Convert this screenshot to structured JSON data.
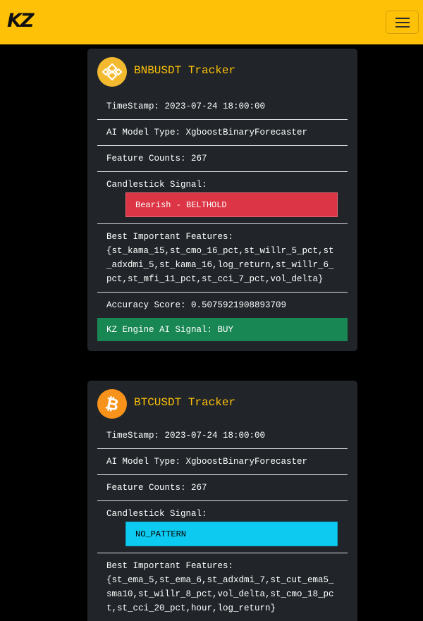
{
  "navbar": {
    "brand": "KZ",
    "menu_icon": "hamburger-menu-icon"
  },
  "colors": {
    "accent": "#ffc107",
    "card_bg": "#212529",
    "bearish": "#dc3545",
    "no_pattern": "#0dcaf0",
    "buy": "#198754"
  },
  "cards": [
    {
      "title": "BNBUSDT Tracker",
      "icon": "binance-coin-icon",
      "timestamp": "TimeStamp: 2023-07-24 18:00:00",
      "model_type": "AI Model Type: XgboostBinaryForecaster",
      "feature_counts": "Feature Counts: 267",
      "candlestick_label": "Candlestick Signal:",
      "candlestick_value": "Bearish - BELTHOLD",
      "features_label": "Best Important Features:",
      "features_value": "{st_kama_15,st_cmo_16_pct,st_willr_5_pct,st_adxdmi_5,st_kama_16,log_return,st_willr_6_pct,st_mfi_11_pct,st_cci_7_pct,vol_delta}",
      "accuracy": "Accuracy Score: 0.5075921908893709",
      "engine_signal": "KZ Engine AI Signal: BUY"
    },
    {
      "title": "BTCUSDT Tracker",
      "icon": "bitcoin-icon",
      "timestamp": "TimeStamp: 2023-07-24 18:00:00",
      "model_type": "AI Model Type: XgboostBinaryForecaster",
      "feature_counts": "Feature Counts: 267",
      "candlestick_label": "Candlestick Signal:",
      "candlestick_value": "NO_PATTERN",
      "features_label": "Best Important Features:",
      "features_value": "{st_ema_5,st_ema_6,st_adxdmi_7,st_cut_ema5_sma10,st_willr_8_pct,vol_delta,st_cmo_18_pct,st_cci_20_pct,hour,log_return}"
    }
  ]
}
